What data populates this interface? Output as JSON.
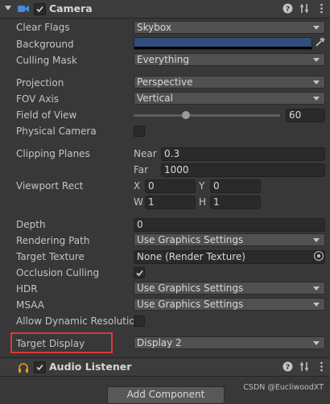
{
  "header": {
    "title": "Camera",
    "icons": [
      "foldout-arrow-icon",
      "camera-icon",
      "enabled-checkbox",
      "help-icon",
      "presets-icon",
      "kebab-menu-icon"
    ]
  },
  "properties": {
    "clear_flags": {
      "label": "Clear Flags",
      "value": "Skybox"
    },
    "background": {
      "label": "Background",
      "color": "#314d79"
    },
    "culling_mask": {
      "label": "Culling Mask",
      "value": "Everything"
    },
    "projection": {
      "label": "Projection",
      "value": "Perspective"
    },
    "fov_axis": {
      "label": "FOV Axis",
      "value": "Vertical"
    },
    "field_of_view": {
      "label": "Field of View",
      "value": "60",
      "slider_fraction": 0.33
    },
    "physical_camera": {
      "label": "Physical Camera",
      "checked": false
    },
    "clipping_planes": {
      "label": "Clipping Planes",
      "near_label": "Near",
      "near": "0.3",
      "far_label": "Far",
      "far": "1000"
    },
    "viewport_rect": {
      "label": "Viewport Rect",
      "x_label": "X",
      "x": "0",
      "y_label": "Y",
      "y": "0",
      "w_label": "W",
      "w": "1",
      "h_label": "H",
      "h": "1"
    },
    "depth": {
      "label": "Depth",
      "value": "0"
    },
    "rendering_path": {
      "label": "Rendering Path",
      "value": "Use Graphics Settings"
    },
    "target_texture": {
      "label": "Target Texture",
      "value": "None (Render Texture)"
    },
    "occlusion_culling": {
      "label": "Occlusion Culling",
      "checked": true
    },
    "hdr": {
      "label": "HDR",
      "value": "Use Graphics Settings"
    },
    "msaa": {
      "label": "MSAA",
      "value": "Use Graphics Settings"
    },
    "allow_dynamic_resolution": {
      "label": "Allow Dynamic Resolutio",
      "checked": false
    },
    "target_display": {
      "label": "Target Display",
      "value": "Display 2"
    }
  },
  "audio_listener": {
    "title": "Audio Listener"
  },
  "add_component": {
    "label": "Add Component"
  },
  "watermark": "CSDN @EucliwoodXT",
  "colors": {
    "highlight": "#e0363a",
    "panel": "#383838",
    "field": "#515151"
  }
}
